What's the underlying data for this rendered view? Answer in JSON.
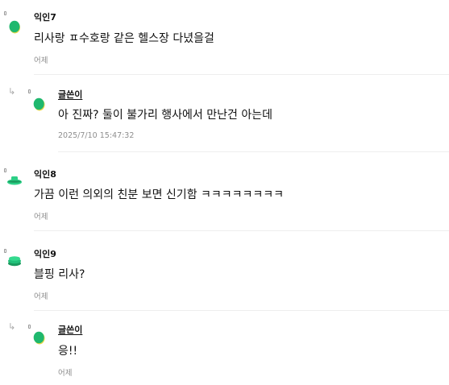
{
  "comments": [
    {
      "author": "익인7",
      "text": "리사랑 ㅍ수호랑 같은 헬스장 다녔을걸",
      "time": "어제",
      "avatar_color": "#1fb86e",
      "is_reply": false
    },
    {
      "author": "글쓴이",
      "text": "아 진짜? 둘이 불가리 행사에서 만난건 아는데",
      "time": "2025/7/10 15:47:32",
      "avatar_color": "#1fb86e",
      "is_reply": true
    },
    {
      "author": "익인8",
      "text": "가끔 이런 의외의 친분 보면 신기함 ㅋㅋㅋㅋㅋㅋㅋㅋ",
      "time": "어제",
      "avatar_color": "#2ccf86",
      "is_reply": false
    },
    {
      "author": "익인9",
      "text": "블핑 리사?",
      "time": "어제",
      "avatar_color": "#22c07a",
      "is_reply": false
    },
    {
      "author": "글쓴이",
      "text": "응!!",
      "time": "어제",
      "avatar_color": "#1fb86e",
      "is_reply": true
    }
  ],
  "icons": {
    "reply": "reply-arrow-icon",
    "avatar": "avatar-icon",
    "marker": "comment-marker-icon"
  },
  "colors": {
    "accent_green": "#1fb86e",
    "accent_yellow": "#e8d84a",
    "meta_gray": "#8e8e8e",
    "divider": "#eeeeee"
  }
}
